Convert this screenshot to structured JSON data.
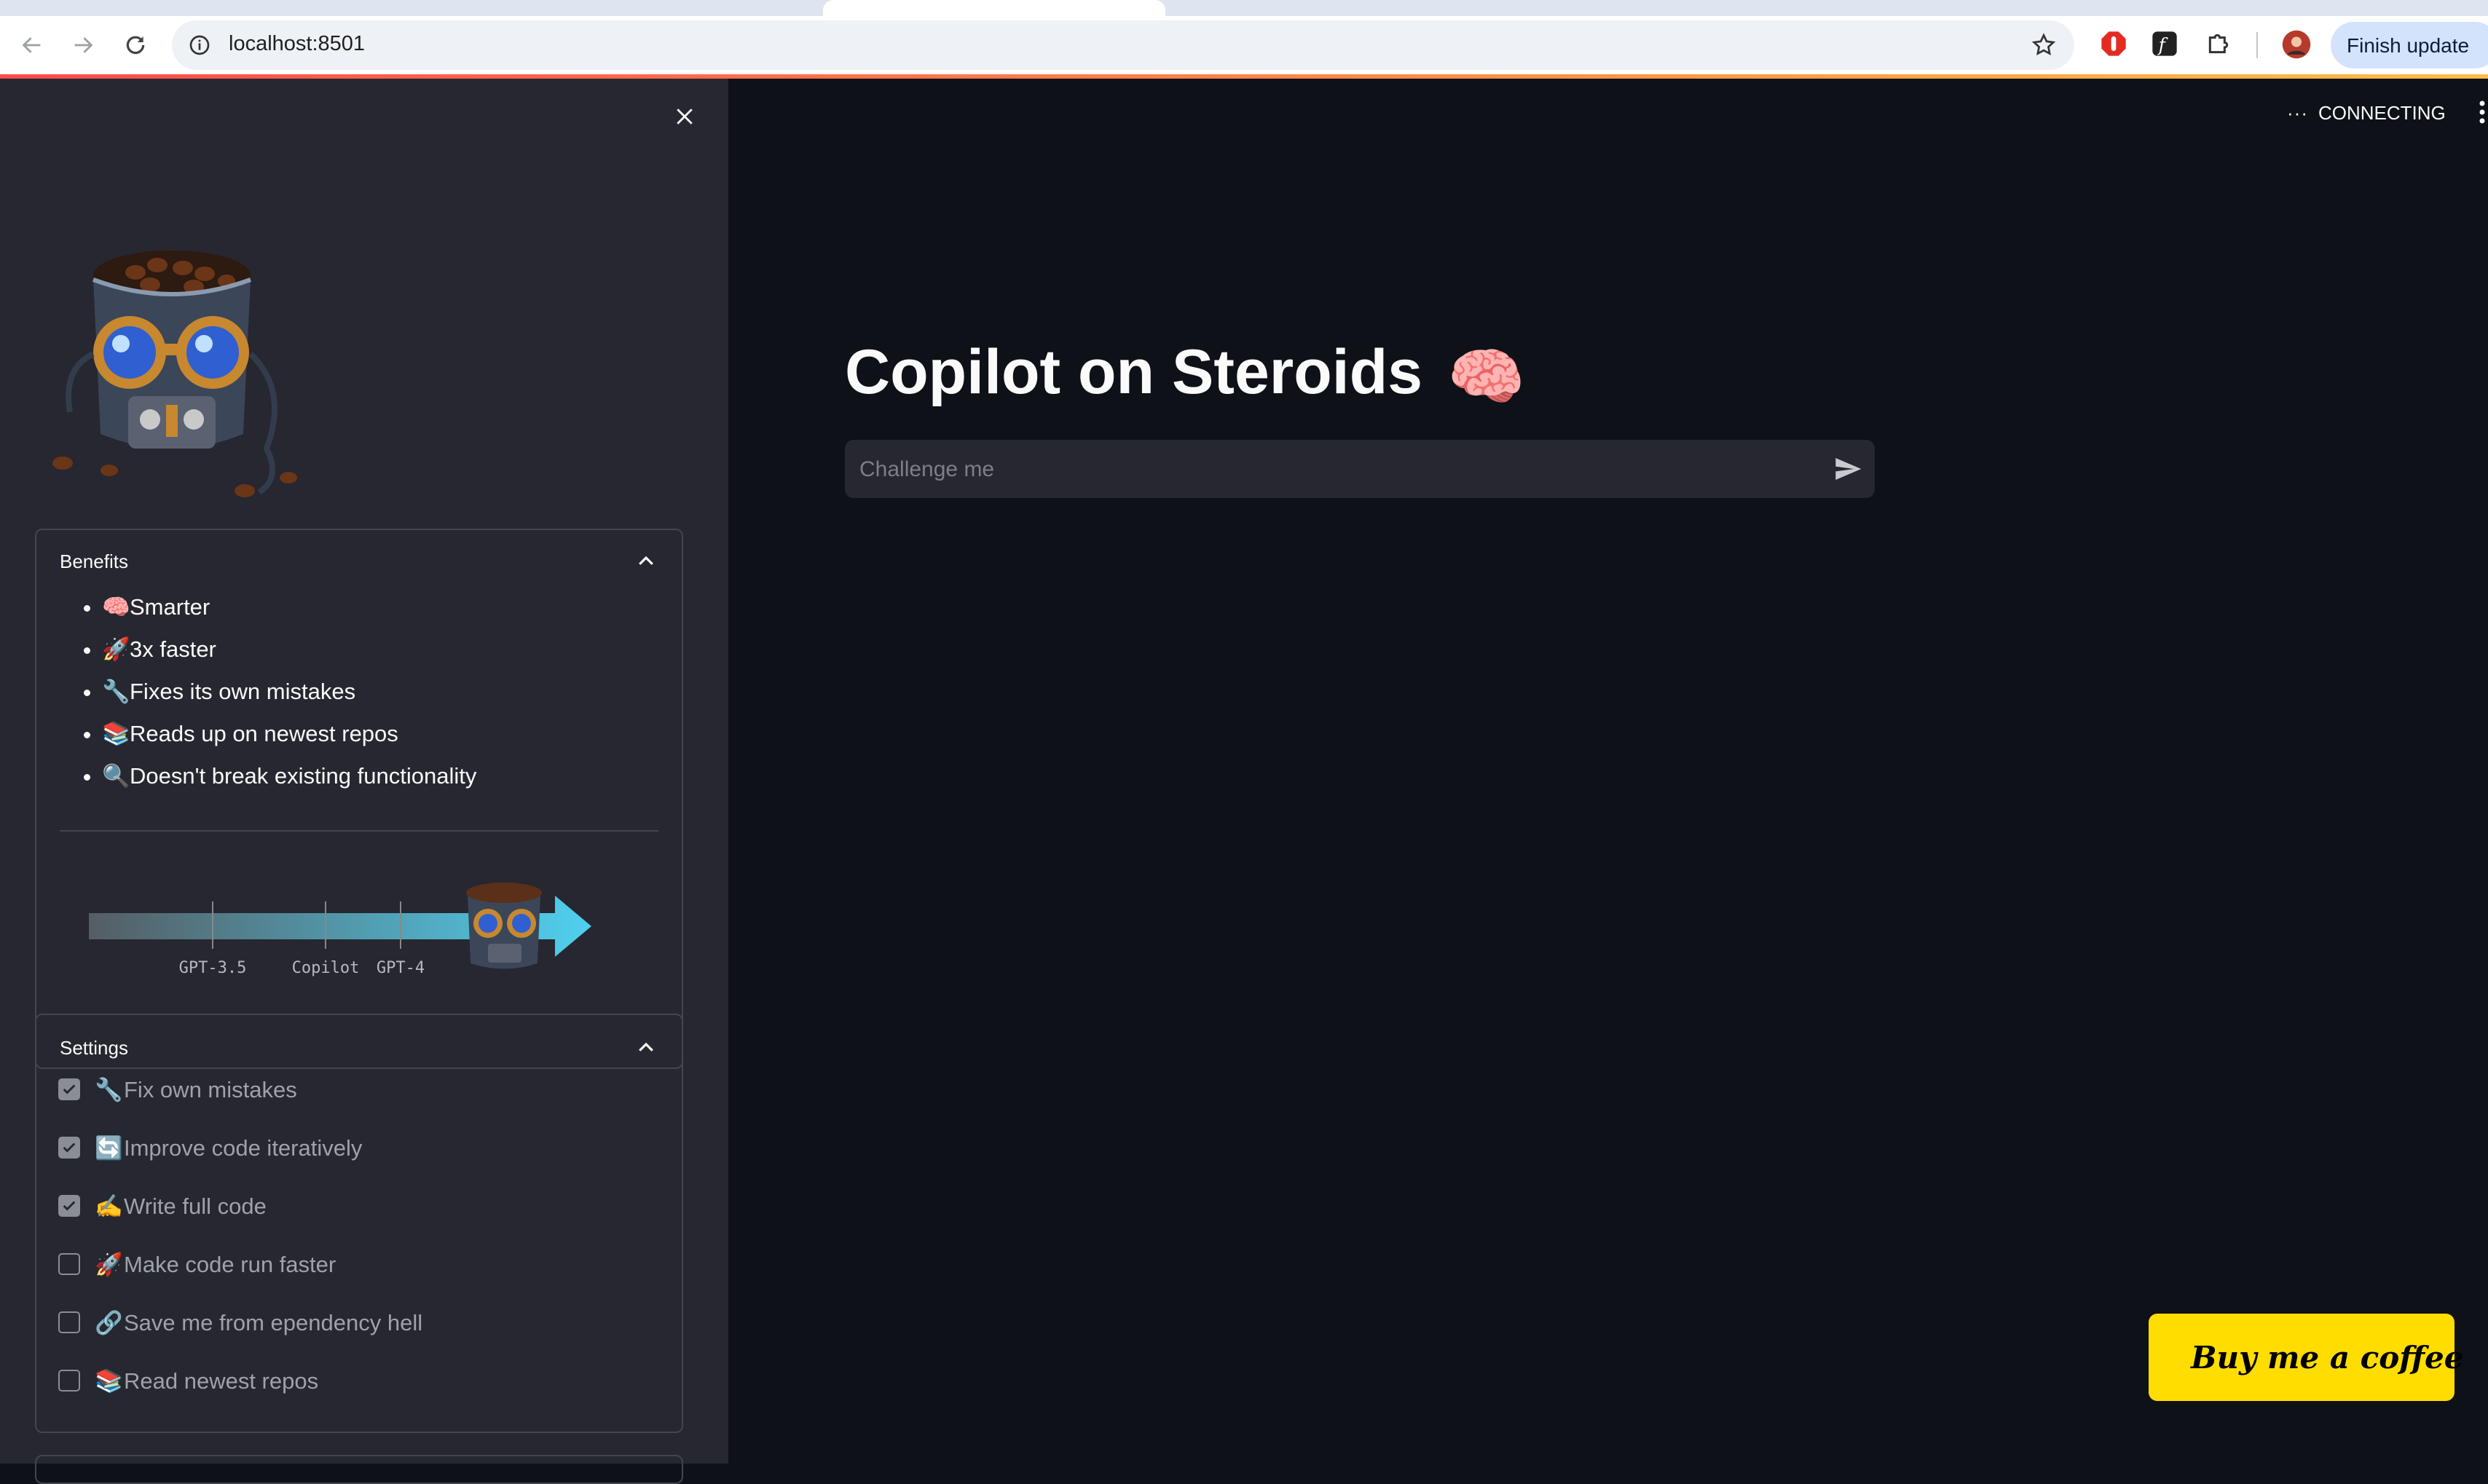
{
  "browser": {
    "url": "localhost:8501",
    "update_label": "Finish update"
  },
  "sidebar": {
    "benefits": {
      "title": "Benefits",
      "items": [
        {
          "icon": "🧠",
          "text": "Smarter"
        },
        {
          "icon": "🚀",
          "text": "3x faster"
        },
        {
          "icon": "🔧",
          "text": "Fixes its own mistakes"
        },
        {
          "icon": "📚",
          "text": "Reads up on newest repos"
        },
        {
          "icon": "🔍",
          "text": "Doesn't break existing functionality"
        }
      ],
      "scale_labels": [
        "GPT-3.5",
        "Copilot",
        "GPT-4"
      ]
    },
    "settings": {
      "title": "Settings",
      "options": [
        {
          "icon": "🔧",
          "label": "Fix own mistakes",
          "checked": true
        },
        {
          "icon": "🔄",
          "label": "Improve code iteratively",
          "checked": true
        },
        {
          "icon": "✍️",
          "label": "Write full code",
          "checked": true
        },
        {
          "icon": "🚀",
          "label": "Make code run faster",
          "checked": false
        },
        {
          "icon": "🔗",
          "label": "Save me from ependency hell",
          "checked": false
        },
        {
          "icon": "📚",
          "label": "Read newest repos",
          "checked": false
        }
      ]
    }
  },
  "main": {
    "status": "CONNECTING",
    "title": "Copilot on Steroids",
    "title_emoji": "🧠",
    "chat_placeholder": "Challenge me",
    "coffee_button": "Buy me a coffee"
  },
  "colors": {
    "sidebar_bg": "#262730",
    "main_bg": "#0e1117",
    "coffee_yellow": "#ffdd00",
    "scale_arrow": "#4fd0ef"
  }
}
